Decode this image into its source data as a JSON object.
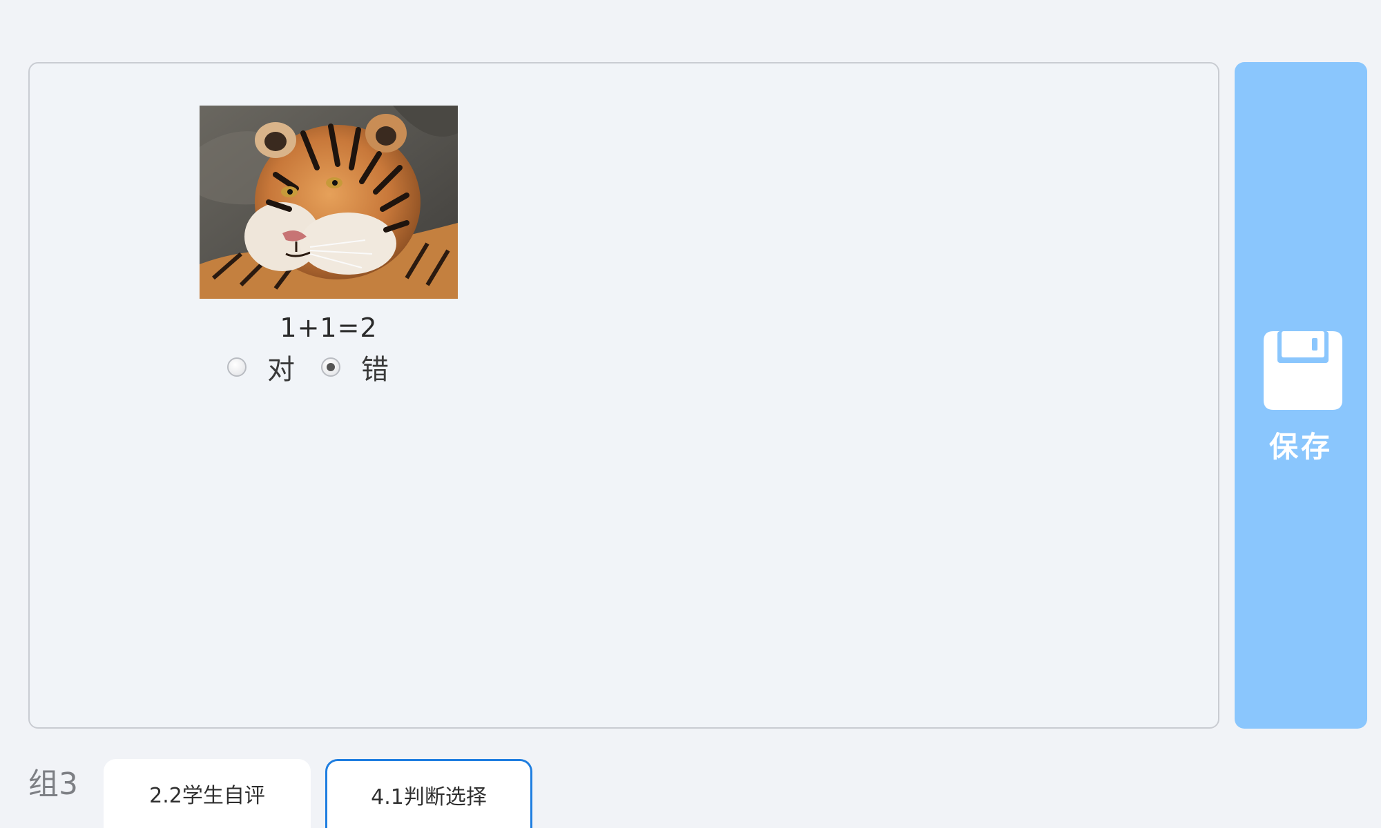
{
  "question": {
    "text": "1+1=2",
    "image_alt": "tiger photo",
    "options": [
      {
        "label": "对",
        "selected": false
      },
      {
        "label": "错",
        "selected": true
      }
    ]
  },
  "save_button": {
    "label": "保存",
    "icon": "floppy-disk-icon"
  },
  "footer": {
    "group_label": "组3",
    "tabs": [
      {
        "label": "2.2学生自评",
        "active": false
      },
      {
        "label": "4.1判断选择",
        "active": true
      }
    ]
  },
  "colors": {
    "background": "#f1f3f7",
    "save_button": "#8ac6fd",
    "active_tab_border": "#1f7ee0",
    "panel_border": "#c9ccd2"
  }
}
